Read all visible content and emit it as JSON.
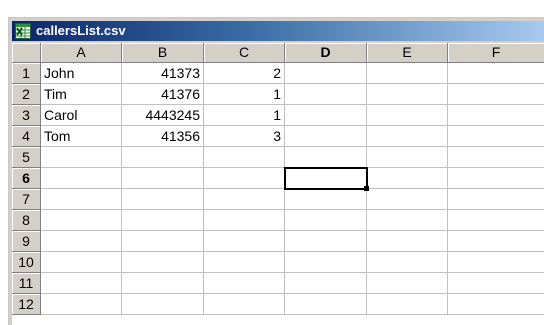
{
  "window": {
    "title": "callersList.csv",
    "icon": "excel-icon"
  },
  "sheet": {
    "columns": [
      "A",
      "B",
      "C",
      "D",
      "E",
      "F"
    ],
    "active_column": "D",
    "row_numbers": [
      "1",
      "2",
      "3",
      "4",
      "5",
      "6",
      "7",
      "8",
      "9",
      "10",
      "11",
      "12"
    ],
    "active_row": "6",
    "rows": [
      [
        "John",
        "41373",
        "2",
        "",
        "",
        ""
      ],
      [
        "Tim",
        "41376",
        "1",
        "",
        "",
        ""
      ],
      [
        "Carol",
        "4443245",
        "1",
        "",
        "",
        ""
      ],
      [
        "Tom",
        "41356",
        "3",
        "",
        "",
        ""
      ],
      [
        "",
        "",
        "",
        "",
        "",
        ""
      ],
      [
        "",
        "",
        "",
        "",
        "",
        ""
      ],
      [
        "",
        "",
        "",
        "",
        "",
        ""
      ],
      [
        "",
        "",
        "",
        "",
        "",
        ""
      ],
      [
        "",
        "",
        "",
        "",
        "",
        ""
      ],
      [
        "",
        "",
        "",
        "",
        "",
        ""
      ],
      [
        "",
        "",
        "",
        "",
        "",
        ""
      ],
      [
        "",
        "",
        "",
        "",
        "",
        ""
      ]
    ],
    "numeric_columns": [
      "B",
      "C"
    ],
    "selected_cell": "D6"
  },
  "colors": {
    "title_bar_start": "#0a246a",
    "title_bar_end": "#a6caf0",
    "header_bg": "#d4d0c8",
    "gridline": "#c0c0c0"
  }
}
